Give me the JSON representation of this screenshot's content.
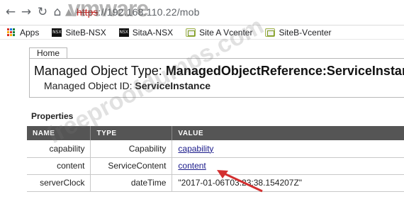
{
  "browser": {
    "url_scheme": "https",
    "url_rest": "://192.168.110.22/mob",
    "watermark": "vmware",
    "icons": {
      "back": "back-arrow-icon",
      "forward": "forward-arrow-icon",
      "reload": "reload-icon",
      "home": "home-icon",
      "warning": "not-secure-warning-icon"
    }
  },
  "bookmarks": [
    {
      "label": "Apps",
      "icon": "apps-grid-icon"
    },
    {
      "label": "SiteB-NSX",
      "icon": "nsx-icon"
    },
    {
      "label": "SitaA-NSX",
      "icon": "nsx-icon"
    },
    {
      "label": "Site A Vcenter",
      "icon": "vcenter-icon"
    },
    {
      "label": "SiteB-Vcenter",
      "icon": "vcenter-icon"
    }
  ],
  "page": {
    "home_tab": "Home",
    "mo_type_label": "Managed Object Type:",
    "mo_type_value": "ManagedObjectReference:ServiceInstance",
    "mo_id_label": "Managed Object ID:",
    "mo_id_value": "ServiceInstance",
    "properties_heading": "Properties",
    "table": {
      "headers": [
        "NAME",
        "TYPE",
        "VALUE"
      ],
      "rows": [
        {
          "name": "capability",
          "type": "Capability",
          "value": "capability",
          "is_link": true
        },
        {
          "name": "content",
          "type": "ServiceContent",
          "value": "content",
          "is_link": true
        },
        {
          "name": "serverClock",
          "type": "dateTime",
          "value": "\"2017-01-06T03:23:38.154207Z\"",
          "is_link": false
        }
      ]
    },
    "watermark_diag": "freeproofdumps.com",
    "annotation_color": "#d32f2f"
  }
}
